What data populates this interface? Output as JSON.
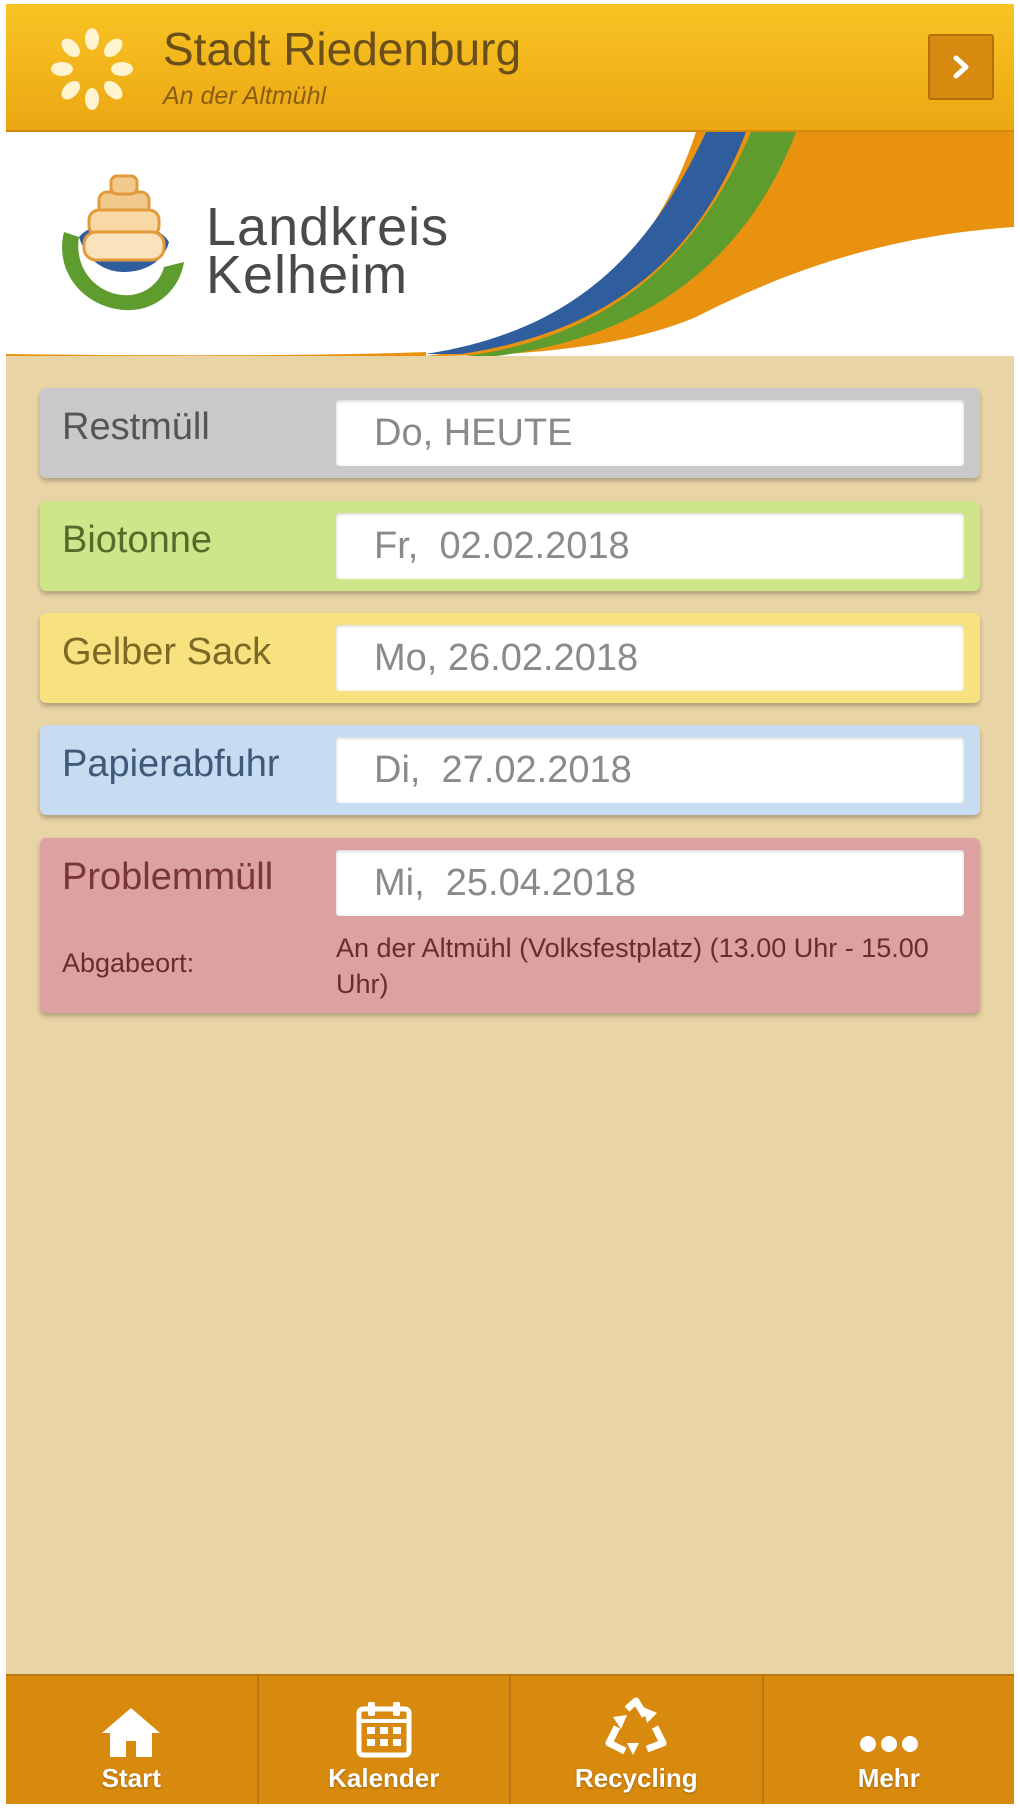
{
  "header": {
    "title": "Stadt Riedenburg",
    "subtitle": "An der Altmühl",
    "next_icon": "chevron-right-icon"
  },
  "banner": {
    "logo_line1": "Landkreis",
    "logo_line2": "Kelheim"
  },
  "schedule": [
    {
      "name": "Restmüll",
      "date": "Do, HEUTE",
      "color": "#c9c9c9",
      "text_color": "#555555"
    },
    {
      "name": "Biotonne",
      "date": "Fr,  02.02.2018",
      "color": "#cfe58a",
      "text_color": "#556b2a"
    },
    {
      "name": "Gelber Sack",
      "date": "Mo, 26.02.2018",
      "color": "#f7e27f",
      "text_color": "#7a6a26"
    },
    {
      "name": "Papierabfuhr",
      "date": "Di,  27.02.2018",
      "color": "#c7dcf0",
      "text_color": "#3f5a78"
    },
    {
      "name": "Problemmüll",
      "date": "Mi,  25.04.2018",
      "color": "#dca2a2",
      "text_color": "#7a3535",
      "location_label": "Abgabeort:",
      "location_value": "An der Altmühl (Volksfestplatz) (13.00 Uhr - 15.00 Uhr)"
    }
  ],
  "nav": [
    {
      "label": "Start",
      "icon": "home-icon",
      "active": true
    },
    {
      "label": "Kalender",
      "icon": "calendar-icon",
      "active": false
    },
    {
      "label": "Recycling",
      "icon": "recycle-icon",
      "active": false
    },
    {
      "label": "Mehr",
      "icon": "more-dots-icon",
      "active": false
    }
  ]
}
